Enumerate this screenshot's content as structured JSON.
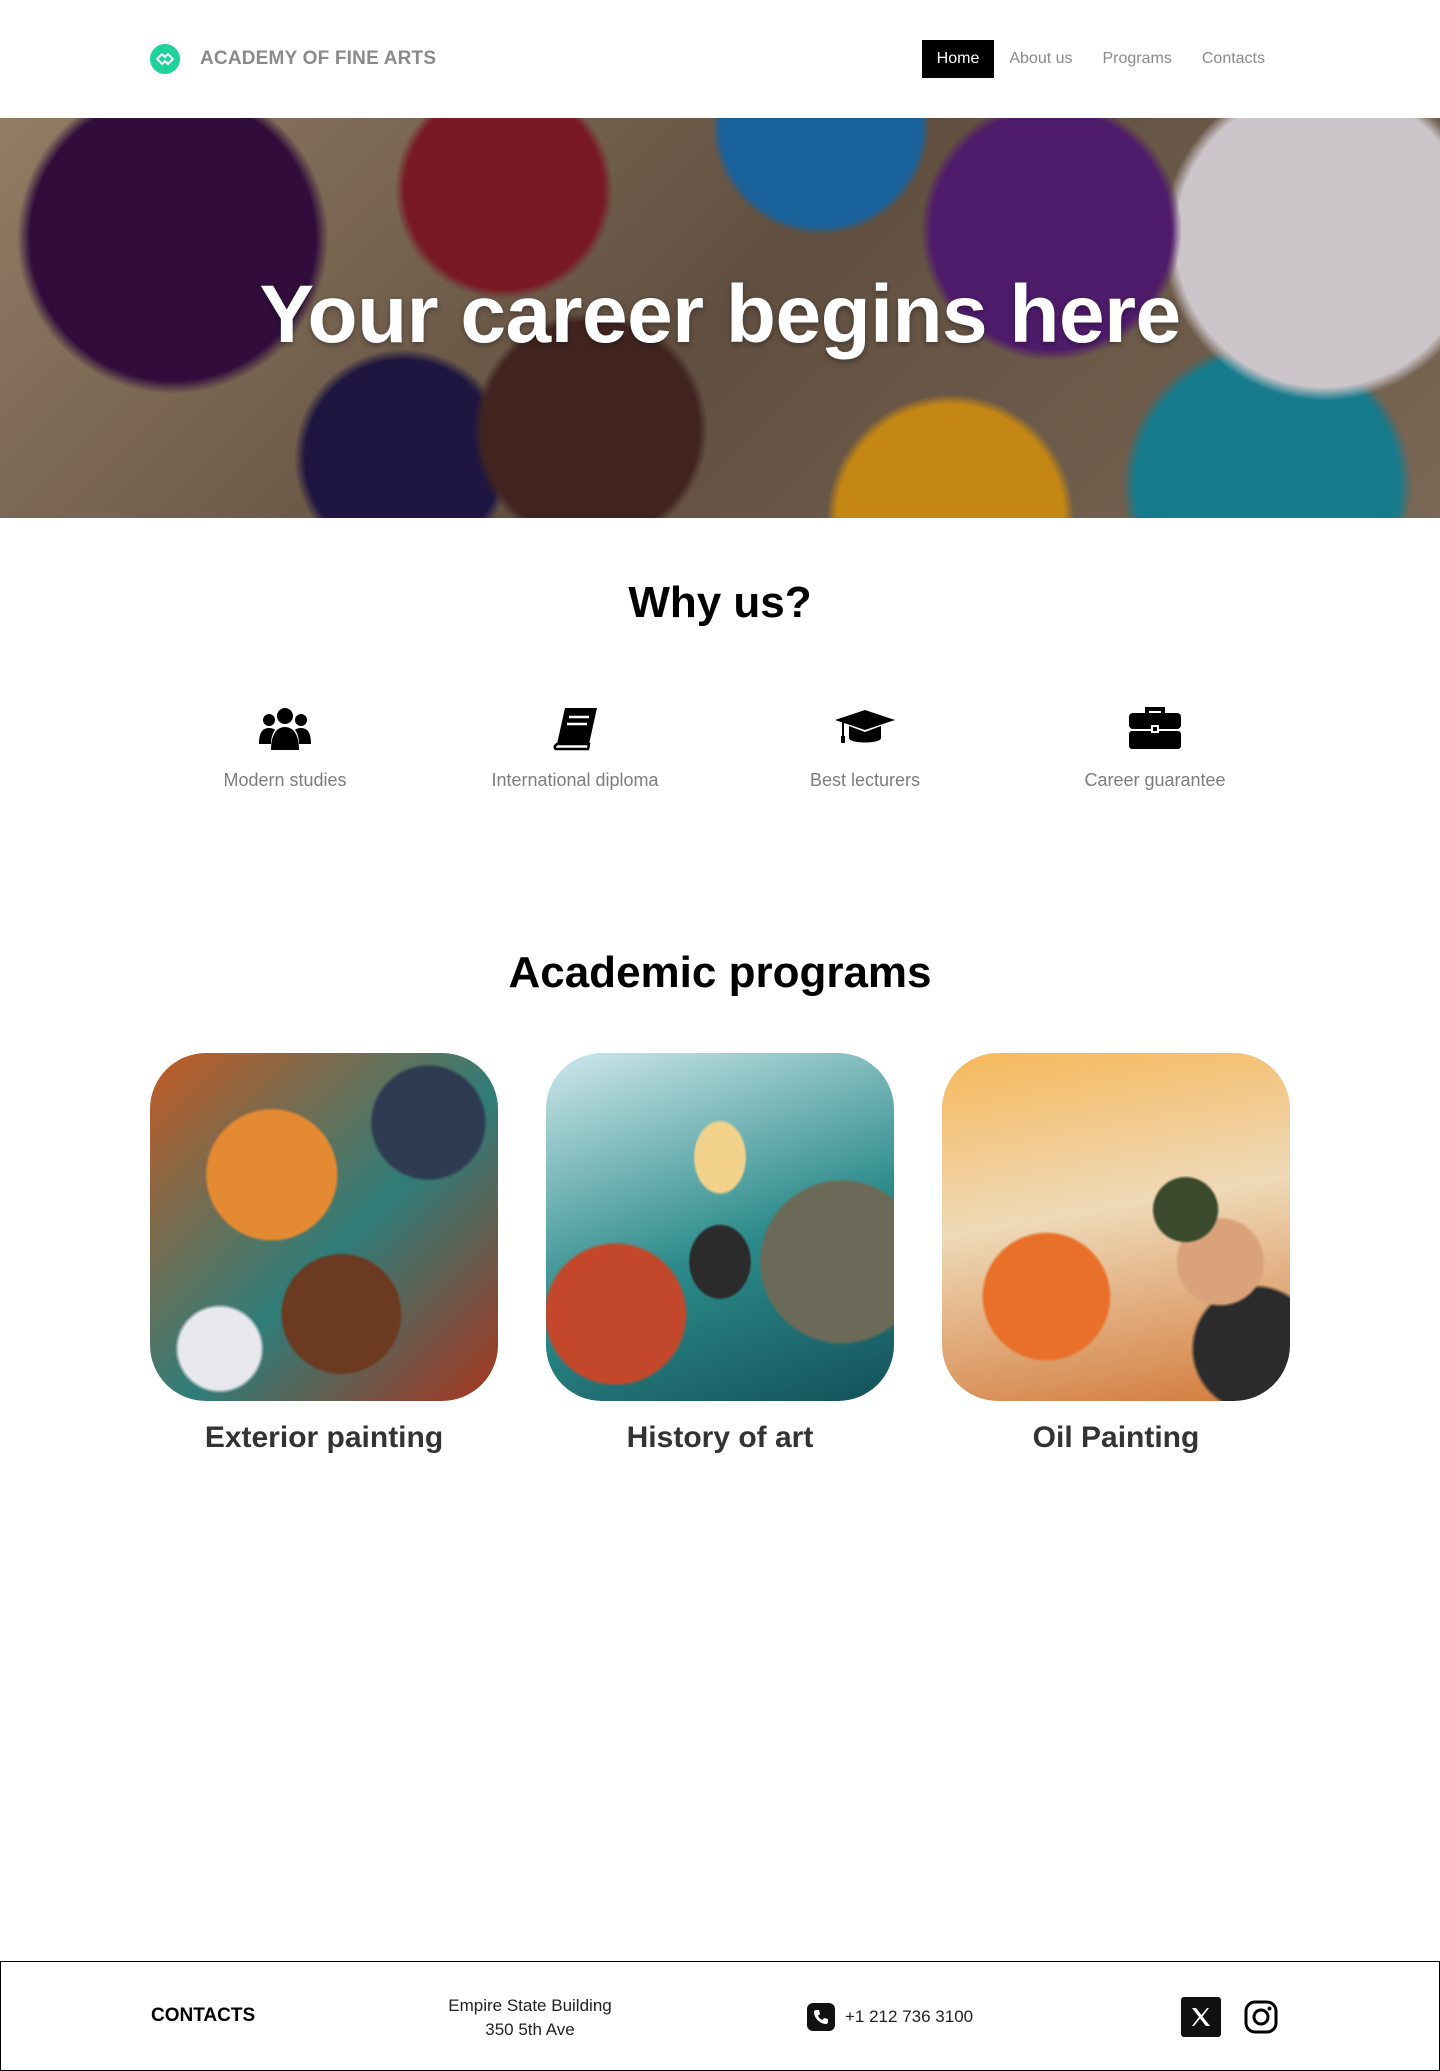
{
  "header": {
    "brand_name": "ACADEMY OF FINE ARTS",
    "nav": [
      "Home",
      "About us",
      "Programs",
      "Contacts"
    ],
    "active_nav": "Home"
  },
  "hero": {
    "title": "Your career begins here"
  },
  "why_us": {
    "title": "Why us?",
    "features": [
      {
        "icon": "users-icon",
        "label": "Modern studies"
      },
      {
        "icon": "book-icon",
        "label": "International diploma"
      },
      {
        "icon": "graduation-cap-icon",
        "label": "Best lecturers"
      },
      {
        "icon": "briefcase-icon",
        "label": "Career guarantee"
      }
    ]
  },
  "programs": {
    "title": "Academic programs",
    "items": [
      {
        "label": "Exterior painting"
      },
      {
        "label": "History of art"
      },
      {
        "label": "Oil Painting"
      }
    ]
  },
  "footer": {
    "contacts_label": "CONTACTS",
    "address_line1": "Empire State Building",
    "address_line2": "350 5th Ave",
    "phone": "+1 212 736 3100",
    "social": [
      "x-icon",
      "instagram-icon"
    ]
  },
  "colors": {
    "logo": "#1fd19a",
    "nav_active_bg": "#000000",
    "muted_text": "#8a8a8a"
  }
}
